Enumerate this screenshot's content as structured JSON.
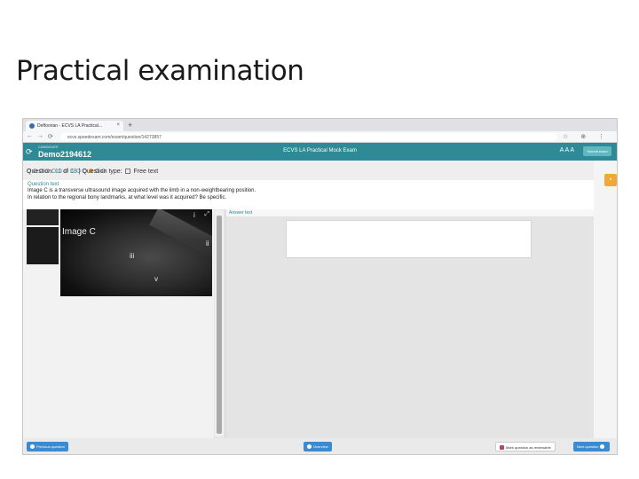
{
  "slide": {
    "title": "Practical examination"
  },
  "browser": {
    "tab_title": "Deftoorian - ECVS LA Practical...",
    "tab_close": "×",
    "new_tab": "+",
    "url": "ecvs.speedexam.com/exam/question/14273857",
    "back": "←",
    "forward": "→",
    "reload": "⟳",
    "right_icons": "☆ ⊕ ⋮"
  },
  "app": {
    "candidate_label": "CANDIDATE",
    "candidate_id": "Demo2194612",
    "refresh": "⟳",
    "exam_title": "ECVS LA Practical Mock Exam",
    "font_sizes": "A A A",
    "end_button": "Submit exam"
  },
  "question_nav": {
    "dot_count": 13,
    "current_index": 10,
    "question_label": "Question:",
    "question_num": "11",
    "of_label": "of",
    "total": "13",
    "separator": "|",
    "type_label": "Question type:",
    "type_value": "Free text"
  },
  "question": {
    "heading": "Question text",
    "line1": "Image C is a transverse ultrasound image acquired with the limb in a non-weightbearing position.",
    "line2": "In relation to the regional bony landmarks, at what level was it acquired? Be specific."
  },
  "images": {
    "thumb1": "",
    "thumb2": "",
    "caption": "Image C",
    "labels": [
      "i",
      "ii",
      "iii",
      "v"
    ],
    "expand": "⤢"
  },
  "answer": {
    "heading": "Answer text"
  },
  "sidebar": {
    "icon": "▪"
  },
  "footer": {
    "prev": "Previous question",
    "overview": "Overview",
    "flag": "Mark question as reviewable",
    "next": "Next question"
  }
}
